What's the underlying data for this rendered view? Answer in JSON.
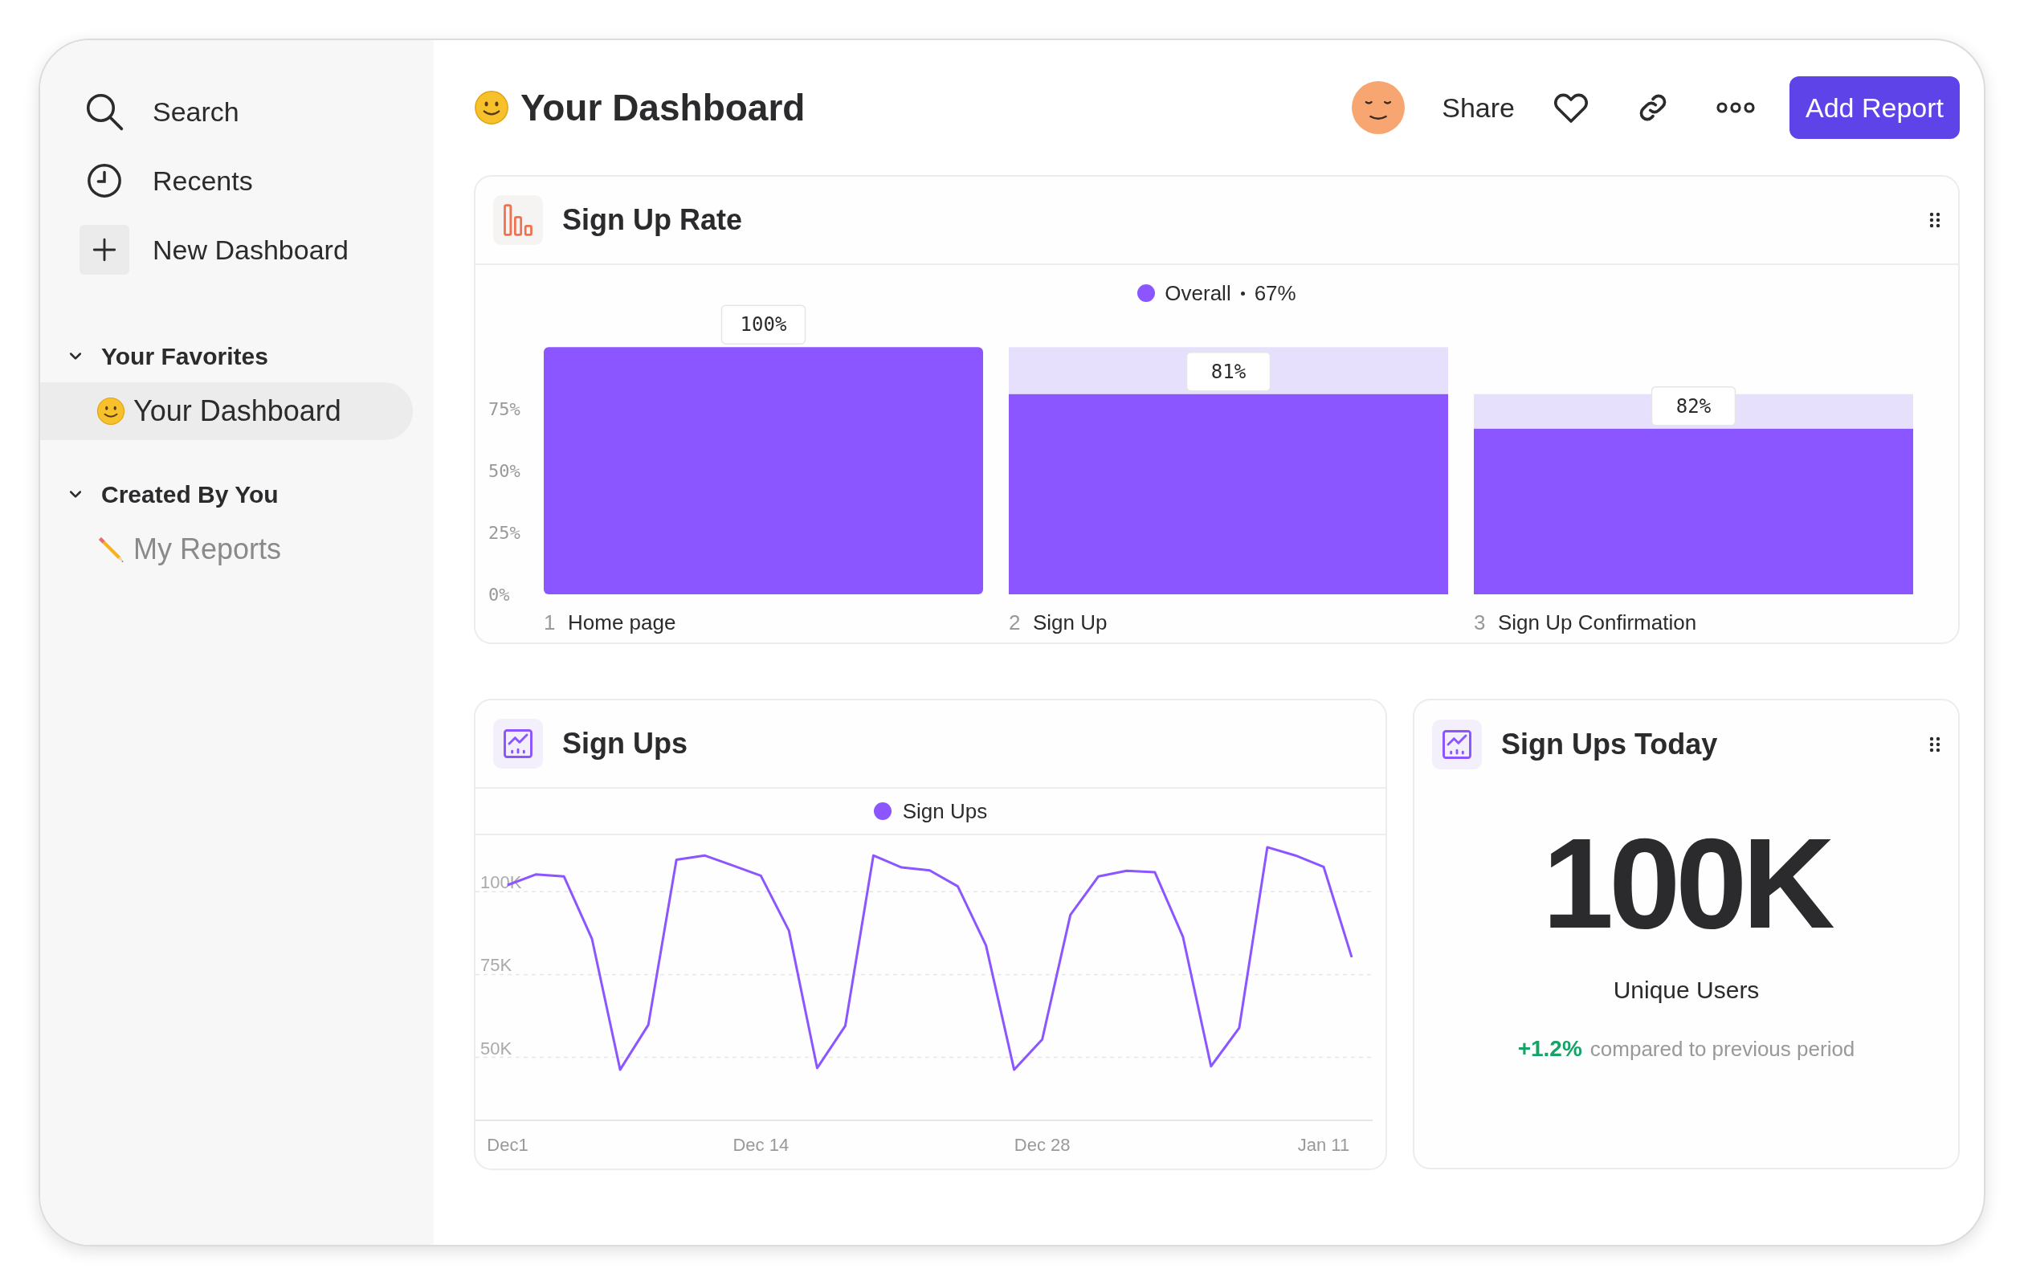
{
  "sidebar": {
    "nav": [
      {
        "label": "Search"
      },
      {
        "label": "Recents"
      },
      {
        "label": "New Dashboard"
      }
    ],
    "sections": [
      {
        "title": "Your Favorites",
        "expanded": true,
        "items": [
          {
            "label": "Your Dashboard",
            "selected": true
          }
        ]
      },
      {
        "title": "Created By You",
        "expanded": true,
        "items": [
          {
            "label": "My Reports",
            "selected": false
          }
        ]
      }
    ]
  },
  "header": {
    "title": "Your Dashboard",
    "share": "Share",
    "add_report": "Add Report"
  },
  "funnel_card": {
    "title": "Sign Up Rate",
    "handle": true,
    "overall_value": "67%",
    "step_numbers": [
      "1",
      "2",
      "3"
    ],
    "chart_data": {
      "type": "bar",
      "categories": [
        "Home page",
        "Sign Up",
        "Sign Up Confirmation"
      ],
      "series": [
        {
          "name": "Overall",
          "color": "#8b55ff",
          "values": [
            100,
            81,
            67
          ]
        }
      ],
      "ylim": [
        0,
        169
      ],
      "yticks": [
        {
          "value": 0,
          "label": "0%"
        },
        {
          "value": 25,
          "label": "25%"
        },
        {
          "value": 50,
          "label": "50%"
        },
        {
          "value": 75,
          "label": "75%"
        }
      ],
      "value_labels": [
        "100%",
        "81%",
        "82%"
      ]
    }
  },
  "line_card": {
    "title": "Sign Ups",
    "handle": false,
    "chart_data": {
      "type": "line",
      "categories": [
        "Dec1",
        null,
        null,
        null,
        null,
        null,
        null,
        null,
        null,
        "Dec 14",
        null,
        null,
        null,
        null,
        null,
        null,
        null,
        null,
        null,
        "Dec 28",
        null,
        null,
        null,
        null,
        null,
        null,
        null,
        null,
        null,
        "Jan 11",
        null
      ],
      "series": [
        {
          "name": "Sign Ups",
          "color": "#8b55ff",
          "values": [
            102.0,
            105.2,
            104.6,
            85.7,
            46.3,
            59.8,
            109.6,
            110.9,
            107.9,
            104.8,
            88.2,
            46.8,
            59.5,
            110.9,
            107.3,
            106.4,
            101.6,
            83.8,
            46.3,
            55.4,
            93.0,
            104.6,
            106.3,
            105.9,
            86.4,
            47.3,
            58.9,
            113.4,
            110.9,
            107.5,
            80.2
          ]
        }
      ],
      "ylim": [
        31,
        158.2
      ],
      "grid": true,
      "yticks": [
        {
          "value": 50,
          "label": "50K"
        },
        {
          "value": 75,
          "label": "75K"
        },
        {
          "value": 100,
          "label": "100K"
        }
      ]
    }
  },
  "stat_card": {
    "title": "Sign Ups Today",
    "handle": true,
    "value": "100K",
    "label": "Unique Users",
    "change": "+1.2%",
    "comparison": "compared to previous period"
  }
}
